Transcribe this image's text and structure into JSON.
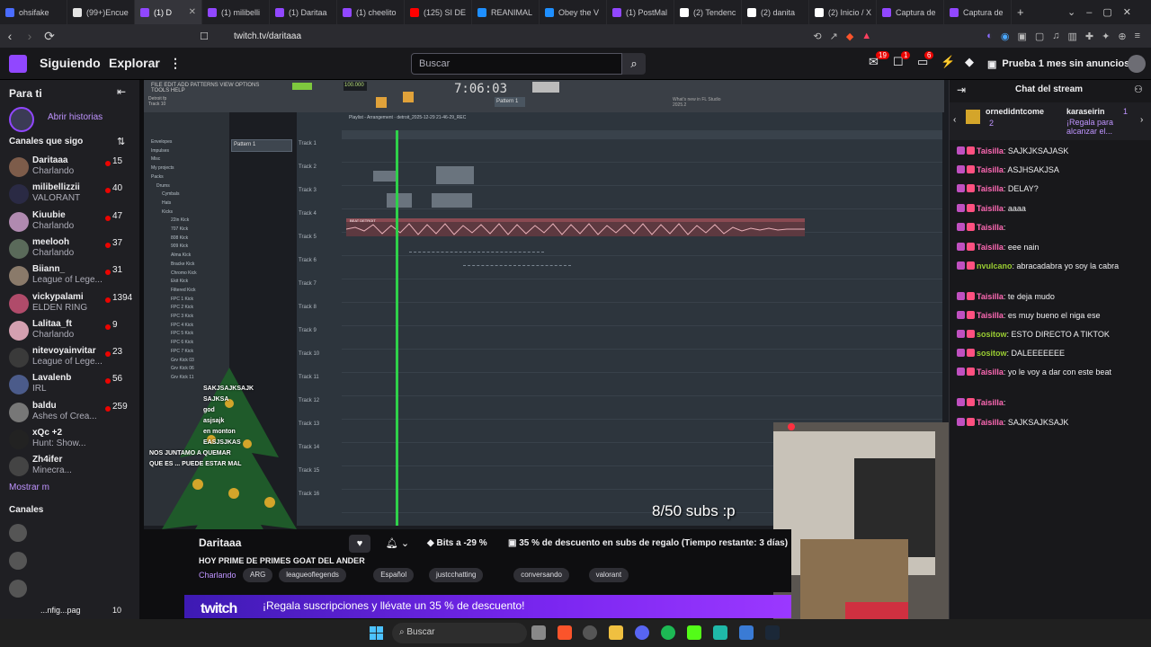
{
  "browser": {
    "tabs": [
      {
        "label": "ohsifake",
        "color": "#4a6cff"
      },
      {
        "label": "(99+)Encue",
        "color": "#e5e5e5"
      },
      {
        "label": "(1) D",
        "color": "#9147ff",
        "active": true
      },
      {
        "label": "(1) milibelli",
        "color": "#9147ff"
      },
      {
        "label": "(1) Daritaa",
        "color": "#9147ff"
      },
      {
        "label": "(1) cheelito",
        "color": "#9147ff"
      },
      {
        "label": "(125) SI DE",
        "color": "#ff0000"
      },
      {
        "label": "REANIMAL",
        "color": "#1e8fff"
      },
      {
        "label": "Obey the V",
        "color": "#1e8fff"
      },
      {
        "label": "(1) PostMal",
        "color": "#9147ff"
      },
      {
        "label": "(2) Tendenc",
        "color": "#ffffff"
      },
      {
        "label": "(2) danita",
        "color": "#ffffff"
      },
      {
        "label": "(2) Inicio / X",
        "color": "#ffffff"
      },
      {
        "label": "Captura de",
        "color": "#9147ff"
      },
      {
        "label": "Captura de",
        "color": "#9147ff"
      }
    ],
    "url": "twitch.tv/daritaaa"
  },
  "header": {
    "following": "Siguiendo",
    "explore": "Explorar",
    "more": "⋮",
    "search_placeholder": "Buscar",
    "notif1": "19",
    "notif2": "1",
    "notif3": "6",
    "prime_label": "Prueba 1 mes sin anuncios"
  },
  "sidebar": {
    "title": "Para ti",
    "stories": "Abrir historias",
    "channels_heading": "Canales que sigo",
    "show_more": "Mostrar m",
    "channels_heading2": "Canales",
    "channels": [
      {
        "name": "Daritaaa",
        "game": "Charlando",
        "viewers": "15",
        "color": "#7d5c4a"
      },
      {
        "name": "milibellizzii",
        "game": "VALORANT",
        "viewers": "40",
        "color": "#2a2a44"
      },
      {
        "name": "Kiuubie",
        "game": "Charlando",
        "viewers": "47",
        "color": "#b08ab0"
      },
      {
        "name": "meelooh",
        "game": "Charlando",
        "viewers": "37",
        "color": "#5a6a5a"
      },
      {
        "name": "Biiann_",
        "game": "League of Lege...",
        "viewers": "31",
        "color": "#8a7a6a"
      },
      {
        "name": "vickypalami",
        "game": "ELDEN RING",
        "viewers": "1394",
        "color": "#b04b6a"
      },
      {
        "name": "Lalitaa_ft",
        "game": "Charlando",
        "viewers": "9",
        "color": "#d4a0b0"
      },
      {
        "name": "nitevoyainvitar",
        "game": "League of Lege...",
        "viewers": "23",
        "color": "#3a3a3a"
      },
      {
        "name": "Lavalenb",
        "game": "IRL",
        "viewers": "56",
        "color": "#4b5b8a"
      },
      {
        "name": "baldu",
        "game": "Ashes of Crea...",
        "viewers": "259",
        "color": "#777777"
      },
      {
        "name": "xQc +2",
        "game": "Hunt: Show...",
        "viewers": "",
        "color": "#222222"
      },
      {
        "name": "Zh4ifer",
        "game": "Minecra...",
        "viewers": "",
        "color": "#444444"
      }
    ],
    "bottom_item": "...nfig...pag",
    "bottom_views": "10"
  },
  "video": {
    "fl_menu": "FILE EDIT ADD PATTERNS VIEW OPTIONS TOOLS HELP",
    "fl_time": "7:06:03",
    "fl_tempo": "100.000",
    "fl_pattern_sel": "Pattern 1",
    "fl_news": "What's new in FL Studio 2025.2",
    "playlist_title": "Playlist - Arrangement · detroit_2025-12-29 21-46-29_REC",
    "pattern_item": "Pattern 1",
    "browser_items": [
      "Envelopes",
      "Impulses",
      "Misc",
      "My projects",
      "Packs",
      "Drums",
      "Cymbals",
      "Hats",
      "Kicks",
      "22in Kick",
      "707 Kick",
      "808 Kick",
      "909 Kick",
      "Alma Kick",
      "Bracke Kick",
      "Chromo Kick",
      "Ekit Kick",
      "Filtered Kick",
      "FPC 1 Kick",
      "FPC 2 Kick",
      "FPC 3 Kick",
      "FPC 4 Kick",
      "FPC 5 Kick",
      "FPC 6 Kick",
      "FPC 7 Kick",
      "Grv Kick 03",
      "Grv Kick 06",
      "Grv Kick 11"
    ],
    "tracks": [
      "Track 1",
      "Track 2",
      "Track 3",
      "Track 4",
      "Track 5",
      "Track 6",
      "Track 7",
      "Track 8",
      "Track 9",
      "Track 10",
      "Track 11",
      "Track 12",
      "Track 13",
      "Track 14",
      "Track 15",
      "Track 16"
    ],
    "clip_label": "BEAT DETROIT",
    "subs_overlay": "8/50 subs :p",
    "overlay_chat": [
      "SAKJSAJKSAJK",
      "SAJKSA",
      "god",
      "asjsajk",
      "en monton",
      "EASJSJKAS",
      "NOS JUNTAMO A QUEMAR",
      "QUE ES ... PUEDE ESTAR MAL"
    ]
  },
  "stream": {
    "streamer": "Daritaaa",
    "title": "HOY PRIME DE PRIMES GOAT DEL ANDER",
    "category": "Charlando",
    "tags": [
      "ARG",
      "leagueoflegends",
      "Español",
      "justcchatting",
      "conversando",
      "valorant"
    ],
    "bits": "Bits a -29 %",
    "discount": "35 % de descuento en subs de regalo (Tiempo restante: 3 días)",
    "promo": "¡Regala suscripciones y llévate un 35 % de descuento!",
    "promo_logo": "twitch"
  },
  "chat": {
    "title": "Chat del stream",
    "pinned_user1": "ornedidntcome",
    "pinned_count1": "2",
    "pinned_user2": "karaseirin",
    "pinned_count2": "1",
    "pinned_text": "¡Regala para alcanzar el...",
    "messages": [
      {
        "user": "Taisilla",
        "text": "SAJKJKSAJASK",
        "color": "#ff69b4"
      },
      {
        "user": "Taisilla",
        "text": "ASJHSAKJSA",
        "color": "#ff69b4"
      },
      {
        "user": "Taisilla",
        "text": "DELAY?",
        "color": "#ff69b4"
      },
      {
        "user": "Taisilla",
        "text": "aaaa",
        "color": "#ff69b4"
      },
      {
        "user": "Taisilla",
        "text": "",
        "color": "#ff69b4"
      },
      {
        "user": "Taisilla",
        "text": "eee nain",
        "color": "#ff69b4"
      },
      {
        "user": "nvulcano",
        "text": "abracadabra yo soy la cabra",
        "color": "#9acd32"
      },
      {
        "user": "Taisilla",
        "text": "te deja mudo",
        "color": "#ff69b4"
      },
      {
        "user": "Taisilla",
        "text": "es muy bueno el niga ese",
        "color": "#ff69b4"
      },
      {
        "user": "sositow",
        "text": "ESTO DIRECTO A TIKTOK",
        "color": "#9acd32"
      },
      {
        "user": "sositow",
        "text": "DALEEEEEEE",
        "color": "#9acd32"
      },
      {
        "user": "Taisilla",
        "text": "yo le voy a dar con este beat",
        "color": "#ff69b4"
      },
      {
        "user": "Taisilla",
        "text": "",
        "color": "#ff69b4"
      },
      {
        "user": "Taisilla",
        "text": "SAJKSAJKSAJK",
        "color": "#ff69b4"
      }
    ]
  },
  "taskbar": {
    "search": "Buscar"
  }
}
